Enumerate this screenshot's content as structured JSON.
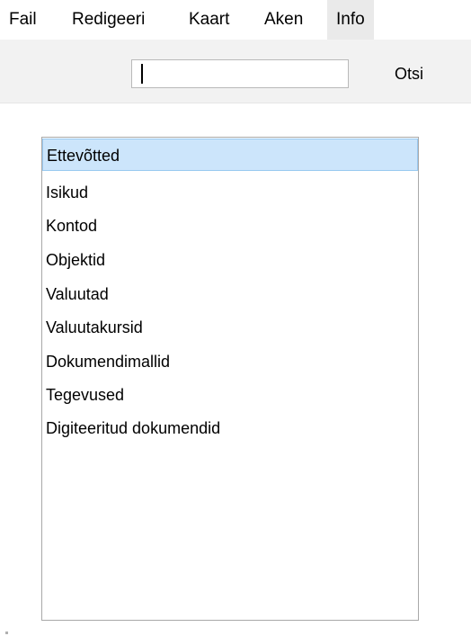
{
  "menu": {
    "items": [
      {
        "label": "Fail"
      },
      {
        "label": "Redigeeri"
      },
      {
        "label": "Kaart"
      },
      {
        "label": "Aken"
      },
      {
        "label": "Info"
      }
    ],
    "active": "Info"
  },
  "toolbar": {
    "search_value": "",
    "search_button_label": "Otsi"
  },
  "list": {
    "items": [
      {
        "label": "Ettevõtted",
        "selected": true
      },
      {
        "label": "Isikud"
      },
      {
        "label": "Kontod"
      },
      {
        "label": "Objektid"
      },
      {
        "label": "Valuutad"
      },
      {
        "label": "Valuutakursid"
      },
      {
        "label": "Dokumendimallid"
      },
      {
        "label": "Tegevused"
      },
      {
        "label": "Digiteeritud dokumendid"
      }
    ]
  },
  "colors": {
    "selection_fill": "#cce5fb",
    "selection_border": "#99c9f0",
    "toolbar_bg": "#f2f2f2",
    "active_menu_bg": "#eaeaea"
  }
}
